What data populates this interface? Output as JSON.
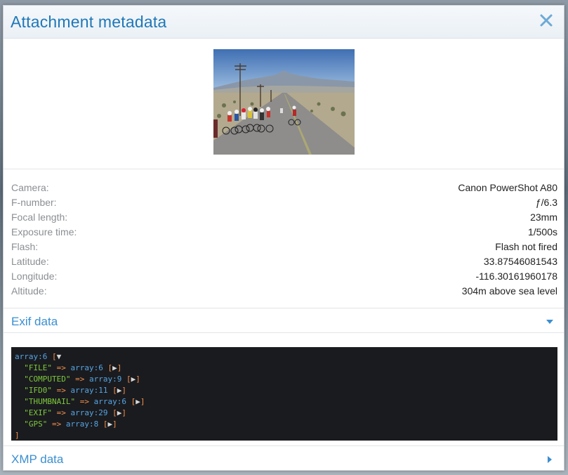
{
  "modal": {
    "title": "Attachment metadata",
    "close_icon": "close-icon"
  },
  "preview": {
    "alt": "Cyclists riding on a desert road with mountains in the background"
  },
  "metadata": [
    {
      "label": "Camera:",
      "value": "Canon PowerShot A80"
    },
    {
      "label": "F-number:",
      "value": "ƒ/6.3"
    },
    {
      "label": "Focal length:",
      "value": "23mm"
    },
    {
      "label": "Exposure time:",
      "value": "1/500s"
    },
    {
      "label": "Flash:",
      "value": "Flash not fired"
    },
    {
      "label": "Latitude:",
      "value": "33.87546081543"
    },
    {
      "label": "Longitude:",
      "value": "-116.30161960178"
    },
    {
      "label": "Altitude:",
      "value": "304m above sea level"
    }
  ],
  "exif": {
    "label": "Exif data",
    "expanded": true,
    "dump": {
      "root": "array:6",
      "open_toggle": "▼",
      "entries": [
        {
          "key": "\"FILE\"",
          "value": "array:6",
          "toggle": "▶"
        },
        {
          "key": "\"COMPUTED\"",
          "value": "array:9",
          "toggle": "▶"
        },
        {
          "key": "\"IFD0\"",
          "value": "array:11",
          "toggle": "▶"
        },
        {
          "key": "\"THUMBNAIL\"",
          "value": "array:6",
          "toggle": "▶"
        },
        {
          "key": "\"EXIF\"",
          "value": "array:29",
          "toggle": "▶"
        },
        {
          "key": "\"GPS\"",
          "value": "array:8",
          "toggle": "▶"
        }
      ],
      "arrow": "=>"
    }
  },
  "xmp": {
    "label": "XMP data",
    "expanded": false
  },
  "colors": {
    "title": "#1f78b8",
    "section": "#3b8fd0",
    "code_bg": "#1a1b1f",
    "code_key": "#7ec83a",
    "code_bracket": "#f2904b",
    "code_value": "#56a5e4"
  }
}
